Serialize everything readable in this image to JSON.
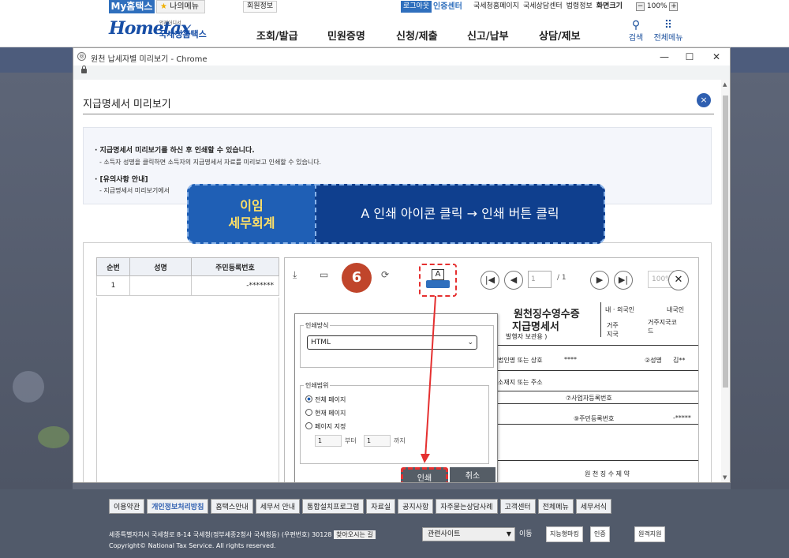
{
  "topbar": {
    "mytax": "My홈택스",
    "mymenu": "나의메뉴",
    "member": "회원정보",
    "logout": "로그아웃",
    "certcenter": "인증센터",
    "links": [
      "국세청홈페이지",
      "국세상담센터",
      "법령정보",
      "화면크기"
    ],
    "zoom": "100%"
  },
  "header": {
    "logo_en": "Hometax",
    "logo_ko": "국세청홈택스",
    "logo_small": "언제어디서",
    "gnb": [
      "조회/발급",
      "민원증명",
      "신청/제출",
      "신고/납부",
      "상담/제보"
    ],
    "search": "검색",
    "allmenu": "전체메뉴"
  },
  "window": {
    "title": "원천 납세자별 미리보기 - Chrome",
    "minimize": "—",
    "maximize": "☐",
    "close": "✕"
  },
  "popup": {
    "title": "지급명세서 미리보기",
    "close": "×"
  },
  "notice": {
    "line1": "· 지급명세서 미리보기를 하신 후 인쇄할 수 있습니다.",
    "line2": "- 소득자 성명을 클릭하면 소득자의 지급명세서 자료를 미리보고 인쇄할 수 있습니다.",
    "line3": "· [유의사항 안내]",
    "line4": "- 지급명세서 미리보기에서"
  },
  "banner": {
    "brand1": "이임",
    "brand2": "세무회계",
    "instruction": "A 인쇄 아이콘 클릭 → 인쇄 버튼 클릭"
  },
  "list": {
    "headers": [
      "순번",
      "성명",
      "주민등록번호"
    ],
    "rows": [
      {
        "no": "1",
        "name": "",
        "rrn": "-*******"
      }
    ]
  },
  "viewer": {
    "step": "6",
    "print_glyph": "A",
    "page_current": "1",
    "page_total": "/ 1",
    "zoom": "100%",
    "first": "|◀",
    "prev": "◀",
    "next": "▶",
    "last": "▶|",
    "close": "✕"
  },
  "doc": {
    "title1": "원천징수영수증",
    "title2": "지급명세서",
    "copy": "발행자 보관용  )",
    "hdr1": "내 · 외국인",
    "hdr2": "내국인",
    "hdr3": "거주 지국",
    "hdr4": "거주지국코 드",
    "r1a": "법인명 또는 상호",
    "r1b": "****",
    "r1c": "②성명",
    "r1d": "김**",
    "r2a": "소재지 또는 주소",
    "r3": "⑦사업자등록번호",
    "r4": "⑨주민등록번호",
    "r4v": "-*****",
    "r5": "원 천 징 수 제 약"
  },
  "printdlg": {
    "method_label": "인쇄방식",
    "method_value": "HTML",
    "range_label": "인쇄범위",
    "opt_all": "전체 페이지",
    "opt_current": "현재 페이지",
    "opt_specific": "페이지 지정",
    "from": "1",
    "from_label": "부터",
    "to": "1",
    "to_label": "까지",
    "print": "인쇄",
    "cancel": "취소"
  },
  "footer": {
    "links": [
      "이용약관",
      "개인정보처리방침",
      "홈택스안내",
      "세무서 안내",
      "통합설치프로그램",
      "자료실",
      "공지사항",
      "자주묻는상담사례",
      "고객센터",
      "전체메뉴",
      "세무서식"
    ],
    "address": "세종특별자치시 국세청로 8-14 국세청(정부세종2청사 국세청동) (우편번호) 30128",
    "directions": "찾아오시는 길",
    "copyright": "Copyright© National Tax Service. All rights reserved.",
    "related": "관련사이트",
    "go": "이동",
    "badge1": "지능형마킹",
    "badge2": "인증",
    "badge3": "원격지원"
  }
}
